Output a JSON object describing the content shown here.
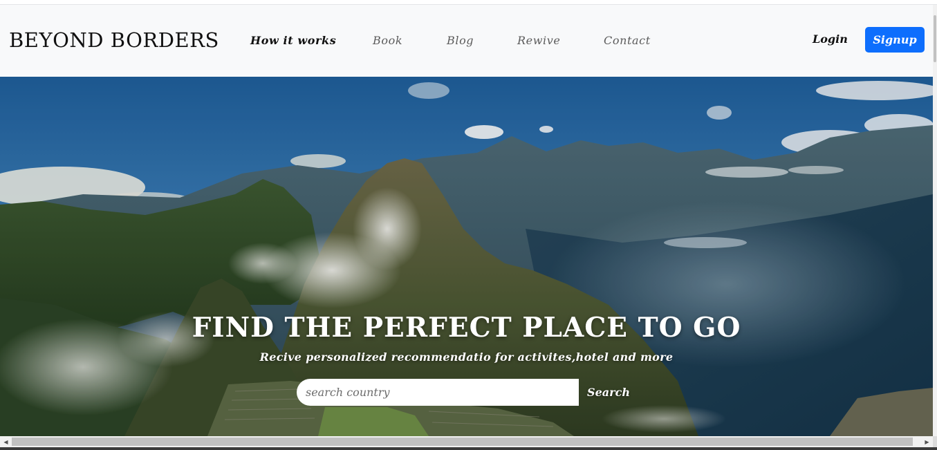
{
  "navbar": {
    "brand": "BEYOND BORDERS",
    "links": [
      "How it works",
      "Book",
      "Blog",
      "Rewive",
      "Contact"
    ],
    "login_label": "Login",
    "signup_label": "Signup"
  },
  "hero": {
    "title": "FIND THE PERFECT PLACE TO GO",
    "subtitle": "Recive personalized recommendatio for activites,hotel and more",
    "search_placeholder": "search country",
    "search_label": "Search"
  },
  "scrollbar": {
    "left_arrow": "◀",
    "right_arrow": "▶"
  },
  "colors": {
    "navbar_bg": "#f8f9fa",
    "signup_bg": "#0d6efd",
    "hero_text": "#ffffff"
  }
}
